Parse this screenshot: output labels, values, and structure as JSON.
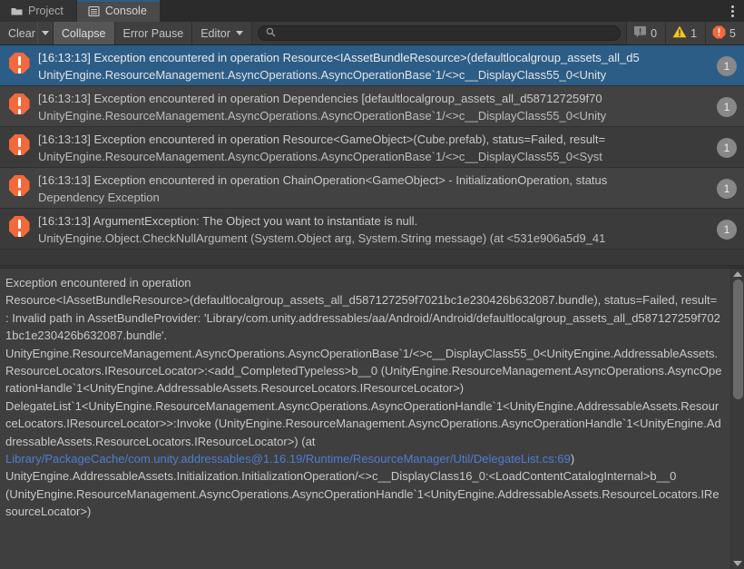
{
  "window": {
    "tabs": [
      {
        "label": "Project",
        "icon": "folder-icon",
        "active": false
      },
      {
        "label": "Console",
        "icon": "console-icon",
        "active": true
      }
    ],
    "menu_icon": "kebab-menu-icon"
  },
  "toolbar": {
    "clear_label": "Clear",
    "clear_dropdown_icon": "chevron-down-icon",
    "collapse_label": "Collapse",
    "error_pause_label": "Error Pause",
    "editor_label": "Editor",
    "editor_dropdown_icon": "chevron-down-icon",
    "search": {
      "icon": "search-icon",
      "value": "",
      "placeholder": ""
    },
    "counters": {
      "info": {
        "icon": "info-icon",
        "count": "0",
        "color": "#8a8a8a"
      },
      "warning": {
        "icon": "warning-icon",
        "count": "1",
        "color": "#f5c518"
      },
      "error": {
        "icon": "error-icon",
        "count": "5",
        "color": "#f2693c"
      }
    }
  },
  "log_entries": [
    {
      "icon": "error-icon",
      "selected": true,
      "count": "1",
      "line1": "[16:13:13] Exception encountered in operation Resource<IAssetBundleResource>(defaultlocalgroup_assets_all_d5",
      "line2": "UnityEngine.ResourceManagement.AsyncOperations.AsyncOperationBase`1/<>c__DisplayClass55_0<Unity"
    },
    {
      "icon": "error-icon",
      "selected": false,
      "count": "1",
      "line1": "[16:13:13] Exception encountered in operation Dependencies [defaultlocalgroup_assets_all_d587127259f70",
      "line2": "UnityEngine.ResourceManagement.AsyncOperations.AsyncOperationBase`1/<>c__DisplayClass55_0<Unity"
    },
    {
      "icon": "error-icon",
      "selected": false,
      "count": "1",
      "line1": "[16:13:13] Exception encountered in operation Resource<GameObject>(Cube.prefab), status=Failed, result=",
      "line2": "UnityEngine.ResourceManagement.AsyncOperations.AsyncOperationBase`1/<>c__DisplayClass55_0<Syst"
    },
    {
      "icon": "error-icon",
      "selected": false,
      "count": "1",
      "line1": "[16:13:13] Exception encountered in operation ChainOperation<GameObject> - InitializationOperation, status",
      "line2": "Dependency Exception"
    },
    {
      "icon": "error-icon",
      "selected": false,
      "count": "1",
      "line1": "[16:13:13] ArgumentException: The Object you want to instantiate is null.",
      "line2": "UnityEngine.Object.CheckNullArgument (System.Object arg, System.String message) (at <531e906a5d9_41"
    }
  ],
  "detail": {
    "part1": "Exception encountered in operation\nResource<IAssetBundleResource>(defaultlocalgroup_assets_all_d587127259f7021bc1e230426b632087.bundle), status=Failed, result= : Invalid path in AssetBundleProvider: 'Library/com.unity.addressables/aa/Android/Android/defaultlocalgroup_assets_all_d587127259f7021bc1e230426b632087.bundle'.\nUnityEngine.ResourceManagement.AsyncOperations.AsyncOperationBase`1/<>c__DisplayClass55_0<UnityEngine.AddressableAssets.ResourceLocators.IResourceLocator>:<add_CompletedTypeless>b__0 (UnityEngine.ResourceManagement.AsyncOperations.AsyncOperationHandle`1<UnityEngine.AddressableAssets.ResourceLocators.IResourceLocator>)\nDelegateList`1<UnityEngine.ResourceManagement.AsyncOperations.AsyncOperationHandle`1<UnityEngine.AddressableAssets.ResourceLocators.IResourceLocator>>:Invoke (UnityEngine.ResourceManagement.AsyncOperations.AsyncOperationHandle`1<UnityEngine.AddressableAssets.ResourceLocators.IResourceLocator>) (at\n",
    "link": "Library/PackageCache/com.unity.addressables@1.16.19/Runtime/ResourceManager/Util/DelegateList.cs:69",
    "part2": ")\nUnityEngine.AddressableAssets.Initialization.InitializationOperation/<>c__DisplayClass16_0:<LoadContentCatalogInternal>b__0\n(UnityEngine.ResourceManagement.AsyncOperations.AsyncOperationHandle`1<UnityEngine.AddressableAssets.ResourceLocators.IResourceLocator>)"
  },
  "colors": {
    "selection": "#2c5d87",
    "error": "#f2693c",
    "warning": "#f5c518",
    "link": "#4f7dd4",
    "panel_bg": "#383838"
  }
}
